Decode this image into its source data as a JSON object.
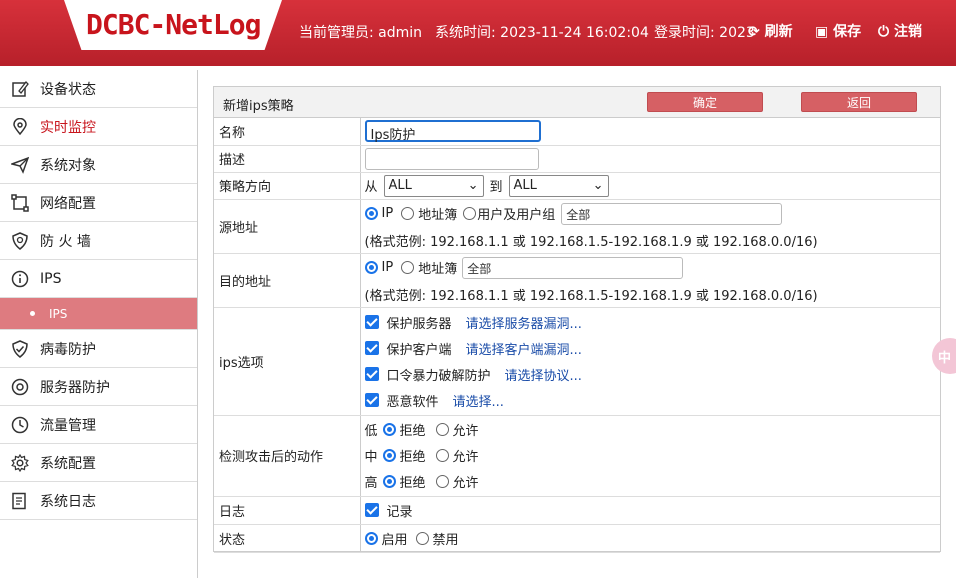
{
  "header": {
    "logo": "DCBC-NetLog",
    "admin": "当前管理员: admin",
    "system_time": "系统时间: 2023-11-24 16:02:04",
    "login_time": "登录时间: 2023",
    "refresh": "刷新",
    "save": "保存",
    "logout": "注销"
  },
  "sidebar": {
    "items": [
      {
        "label": "设备状态",
        "icon": "edit-icon"
      },
      {
        "label": "实时监控",
        "icon": "location-pin-icon"
      },
      {
        "label": "系统对象",
        "icon": "paper-plane-icon"
      },
      {
        "label": "网络配置",
        "icon": "network-icon"
      },
      {
        "label": "防 火 墙",
        "icon": "shield-icon"
      },
      {
        "label": "IPS",
        "icon": "info-icon"
      },
      {
        "label": "IPS",
        "icon": "dot-icon"
      },
      {
        "label": "病毒防护",
        "icon": "shield-check-icon"
      },
      {
        "label": "服务器防护",
        "icon": "target-icon"
      },
      {
        "label": "流量管理",
        "icon": "clock-icon"
      },
      {
        "label": "系统配置",
        "icon": "gear-icon"
      },
      {
        "label": "系统日志",
        "icon": "document-icon"
      }
    ]
  },
  "panel": {
    "title": "新增ips策略",
    "confirm": "确定",
    "back": "返回",
    "rows": {
      "name": {
        "label": "名称",
        "value": "Ips防护"
      },
      "desc": {
        "label": "描述",
        "value": ""
      },
      "direction": {
        "label": "策略方向",
        "from": "从",
        "from_value": "ALL",
        "to": "到",
        "to_value": "ALL"
      },
      "src": {
        "label": "源地址",
        "opt_ip": "IP",
        "opt_book": "地址簿",
        "opt_user": "用户及用户组",
        "value": "全部",
        "hint": "(格式范例: 192.168.1.1 或 192.168.1.5-192.168.1.9 或 192.168.0.0/16)"
      },
      "dst": {
        "label": "目的地址",
        "opt_ip": "IP",
        "opt_book": "地址簿",
        "value": "全部",
        "hint": "(格式范例: 192.168.1.1 或 192.168.1.5-192.168.1.9 或 192.168.0.0/16)"
      },
      "ips": {
        "label": "ips选项",
        "opts": [
          {
            "text": "保护服务器",
            "link": "请选择服务器漏洞..."
          },
          {
            "text": "保护客户端",
            "link": "请选择客户端漏洞..."
          },
          {
            "text": "口令暴力破解防护",
            "link": "请选择协议..."
          },
          {
            "text": "恶意软件",
            "link": "请选择..."
          }
        ]
      },
      "action": {
        "label": "检测攻击后的动作",
        "levels": [
          "低",
          "中",
          "高"
        ],
        "deny": "拒绝",
        "allow": "允许"
      },
      "log": {
        "label": "日志",
        "value": "记录"
      },
      "status": {
        "label": "状态",
        "on": "启用",
        "off": "禁用"
      }
    }
  },
  "floating": "中",
  "colors": {
    "header": "#c8202a",
    "accent": "#1a73e8",
    "button": "#d66064",
    "submenu": "#de7b80"
  }
}
